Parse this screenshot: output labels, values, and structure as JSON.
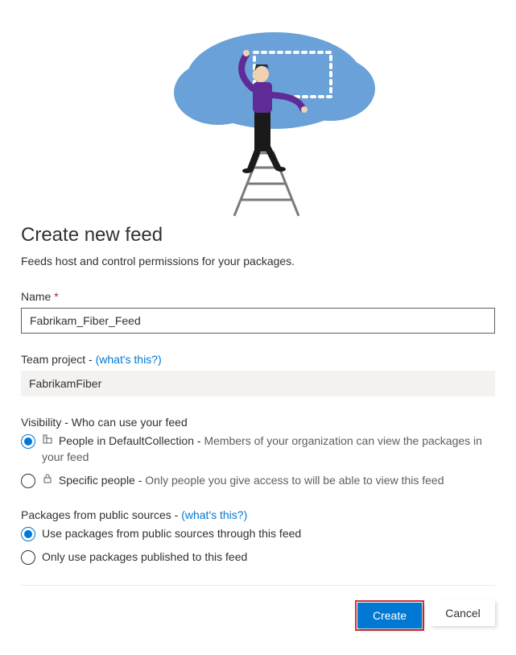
{
  "heading": "Create new feed",
  "subtitle": "Feeds host and control permissions for your packages.",
  "name_field": {
    "label": "Name",
    "required_marker": "*",
    "value": "Fabrikam_Fiber_Feed"
  },
  "team_project": {
    "label": "Team project - ",
    "help_link": "(what's this?)",
    "value": "FabrikamFiber"
  },
  "visibility": {
    "label": "Visibility - Who can use your feed",
    "options": {
      "collection": {
        "prefix": "People in DefaultCollection - ",
        "desc": "Members of your organization can view the packages in your feed",
        "selected": true
      },
      "specific": {
        "prefix": "Specific people - ",
        "desc": "Only people you give access to will be able to view this feed",
        "selected": false
      }
    }
  },
  "public_sources": {
    "label": "Packages from public sources - ",
    "help_link": "(what's this?)",
    "options": {
      "use_public": {
        "label": "Use packages from public sources through this feed",
        "selected": true
      },
      "only_published": {
        "label": "Only use packages published to this feed",
        "selected": false
      }
    }
  },
  "buttons": {
    "create": "Create",
    "cancel": "Cancel"
  }
}
